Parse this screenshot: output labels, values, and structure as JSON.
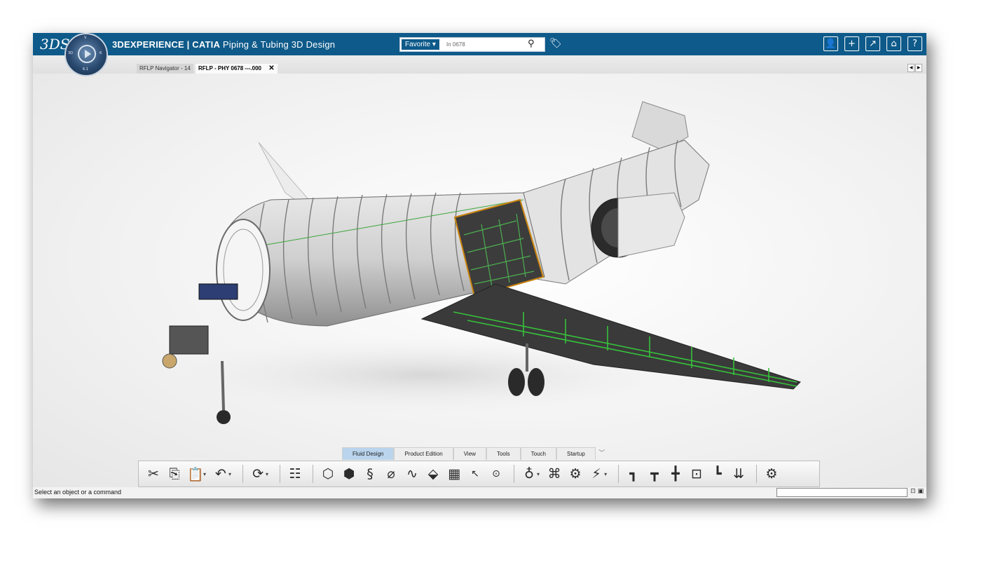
{
  "app": {
    "brand_logo": "3DS",
    "compass_labels": {
      "n": "V",
      "w": "3D",
      "e": "6",
      "s": "6.1"
    },
    "title_brand": "3DEXPERIENCE | CATIA",
    "title_app": "Piping & Tubing 3D Design"
  },
  "search": {
    "scope_label": "Favorite",
    "value": "In 0678",
    "search_icon": "search-icon",
    "tag_icon": "tag-icon"
  },
  "top_icons": [
    "user-icon",
    "add-icon",
    "share-icon",
    "home-icon",
    "help-icon"
  ],
  "top_icon_glyphs": [
    "👤",
    "+",
    "↗",
    "⌂",
    "?"
  ],
  "tabs": [
    {
      "label": "RFLP Navigator - 14"
    },
    {
      "label": "RFLP - PHY 0678 ---.000",
      "close": "✕"
    }
  ],
  "ribbon_tabs": [
    "Fluid Design",
    "Product Edition",
    "View",
    "Tools",
    "Touch",
    "Startup"
  ],
  "toolbar_icons": [
    "cut-icon",
    "copy-icon",
    "paste-icon",
    "undo-icon",
    "update-icon",
    "tree-icon",
    "pipe-icon",
    "tube-icon",
    "spring-pipe-icon",
    "bent-pipe-icon",
    "route-icon",
    "part-icon",
    "spec-icon",
    "select-icon",
    "next-icon",
    "route-tool-icon",
    "network-icon",
    "connect-icon",
    "flow-icon",
    "branch-icon",
    "spool-icon",
    "split-icon",
    "catalog-icon",
    "break-icon",
    "sort-icon",
    "settings-icon"
  ],
  "status": {
    "message": "Select an object or a command",
    "command_value": ""
  },
  "colors": {
    "brand_blue": "#0e5a8a",
    "active_tab": "#b9d4ec",
    "wing_panels": "#2e8b2e",
    "orange_outline": "#c8830f"
  }
}
